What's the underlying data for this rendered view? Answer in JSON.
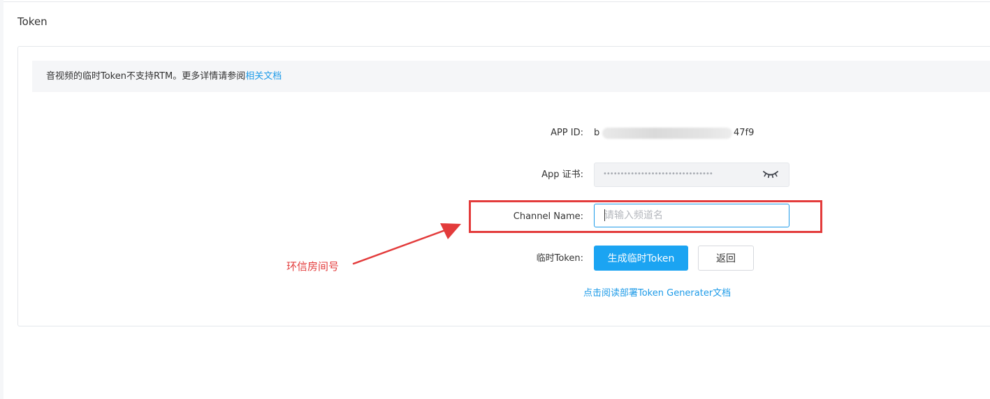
{
  "section": {
    "title": "Token"
  },
  "notice": {
    "text": "音视频的临时Token不支持RTM。更多详情请参阅",
    "link_label": "相关文档"
  },
  "form": {
    "app_id": {
      "label": "APP ID:",
      "value_prefix": "b",
      "value_suffix": "47f9"
    },
    "app_certificate": {
      "label": "App 证书:",
      "masked_value": "••••••••••••••••••••••••••••••••",
      "toggle_icon": "eye-closed-icon"
    },
    "channel_name": {
      "label": "Channel Name:",
      "value": "",
      "placeholder": "请输入频道名"
    },
    "temp_token": {
      "label": "临时Token:",
      "generate_button": "生成临时Token",
      "back_button": "返回"
    },
    "doc_link": "点击阅读部署Token Generater文档"
  },
  "annotation": {
    "text": "环信房间号",
    "color": "#e33b3b"
  },
  "colors": {
    "accent": "#1ba4f2",
    "link": "#1e9be8",
    "highlight": "#e33b3b"
  }
}
